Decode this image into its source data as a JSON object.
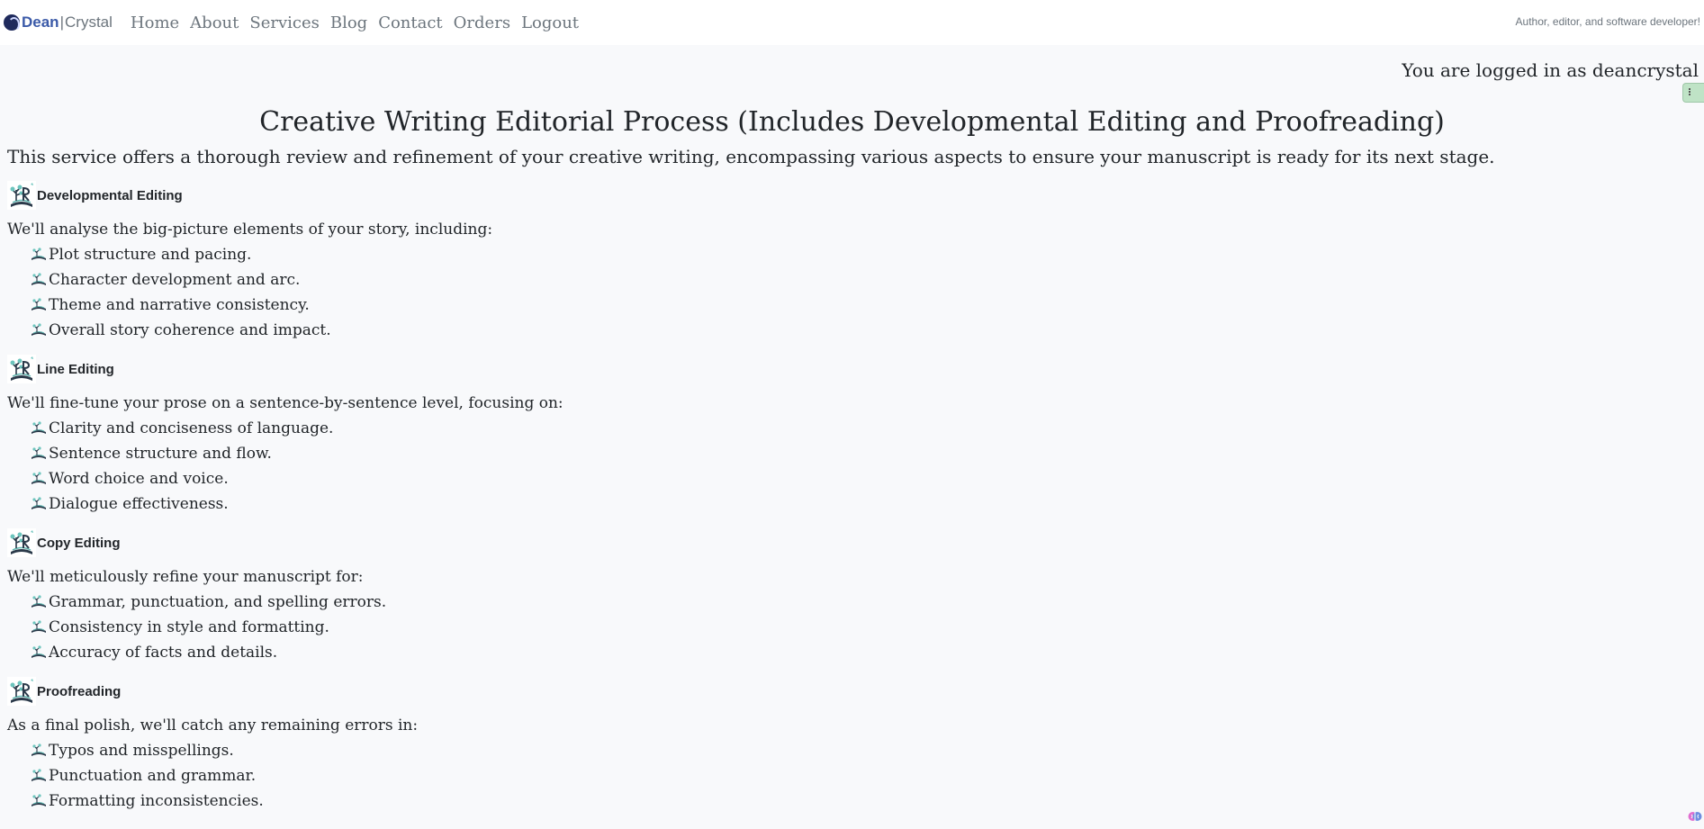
{
  "nav": {
    "brand_first": "Dean",
    "brand_sep": "|",
    "brand_second": "Crystal",
    "links": [
      "Home",
      "About",
      "Services",
      "Blog",
      "Contact",
      "Orders",
      "Logout"
    ],
    "tagline": "Author, editor, and software developer!"
  },
  "user": {
    "logged_in_text": "You are logged in as deancrystal"
  },
  "page": {
    "title": "Creative Writing Editorial Process (Includes Developmental Editing and Proofreading)",
    "intro": "This service offers a thorough review and refinement of your creative writing, encompassing various aspects to ensure your manuscript is ready for its next stage."
  },
  "sections": [
    {
      "title": "Developmental Editing",
      "desc": "We'll analyse the big-picture elements of your story, including:",
      "items": [
        "Plot structure and pacing.",
        "Character development and arc.",
        "Theme and narrative consistency.",
        "Overall story coherence and impact."
      ]
    },
    {
      "title": "Line Editing",
      "desc": "We'll fine-tune your prose on a sentence-by-sentence level, focusing on:",
      "items": [
        "Clarity and conciseness of language.",
        "Sentence structure and flow.",
        "Word choice and voice.",
        "Dialogue effectiveness."
      ]
    },
    {
      "title": "Copy Editing",
      "desc": "We'll meticulously refine your manuscript for:",
      "items": [
        "Grammar, punctuation, and spelling errors.",
        "Consistency in style and formatting.",
        "Accuracy of facts and details."
      ]
    },
    {
      "title": "Proofreading",
      "desc": "As a final polish, we'll catch any remaining errors in:",
      "items": [
        "Typos and misspellings.",
        "Punctuation and grammar.",
        "Formatting inconsistencies."
      ]
    }
  ],
  "icons": {
    "section": "book-tree-icon",
    "bullet": "open-book-icon",
    "corner": "brain-icon"
  },
  "colors": {
    "background": "#f8f9fb",
    "navbar": "#ffffff",
    "brand_accent": "#3b5aa8",
    "link": "#6c757d"
  }
}
